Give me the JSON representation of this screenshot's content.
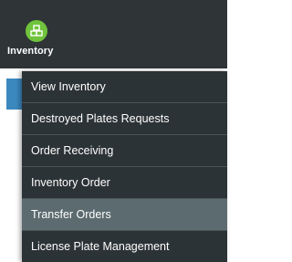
{
  "nav": {
    "module": {
      "label": "Inventory",
      "icon": "boxes-icon",
      "icon_color": "#6fc43c"
    }
  },
  "menu": {
    "items": [
      {
        "label": "View Inventory",
        "active": false
      },
      {
        "label": "Destroyed Plates Requests",
        "active": false
      },
      {
        "label": "Order Receiving",
        "active": false
      },
      {
        "label": "Inventory Order",
        "active": false
      },
      {
        "label": "Transfer Orders",
        "active": true
      },
      {
        "label": "License Plate Management",
        "active": false
      }
    ]
  },
  "colors": {
    "topbar_bg": "#2f3437",
    "menu_bg": "#2c3336",
    "active_item_bg": "#5c6b70",
    "accent_blue": "#3b88bf"
  }
}
